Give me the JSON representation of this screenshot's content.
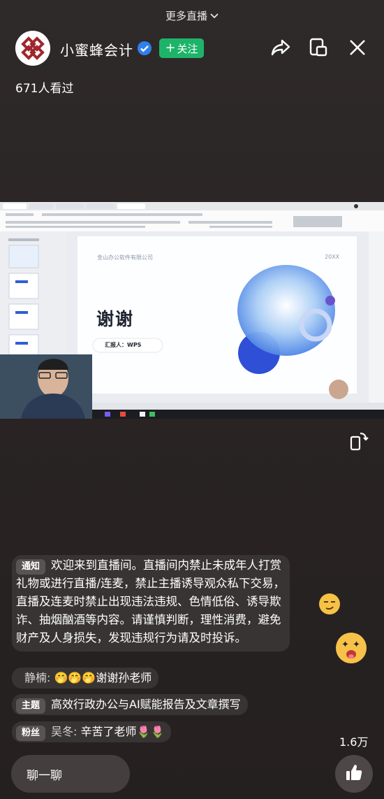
{
  "header": {
    "more_live": "更多直播",
    "host_name": "小蜜蜂会计",
    "follow_label": "关注",
    "viewers": "671人看过"
  },
  "colors": {
    "follow": "#1db46a",
    "verified": "#2f80ed",
    "avatar_brand": "#a0262c"
  },
  "icons": [
    "chevron-down-icon",
    "verified-icon",
    "share-icon",
    "float-window-icon",
    "close-icon",
    "rotate-screen-icon",
    "thumbs-up-icon"
  ],
  "slide": {
    "company": "金山办公软件有限公司",
    "year": "20XX",
    "title": "谢谢",
    "reporter": "汇报人：WPS"
  },
  "chat": {
    "notice_tag": "通知",
    "notice_text": "欢迎来到直播间。直播间内禁止未成年人打赏礼物或进行直播/连麦，禁止主播诱导观众私下交易，直播及连麦时禁止出现违法违规、色情低俗、诱导欺诈、抽烟酗酒等内容。请谨慎判断，理性消费，避免财产及人身损失，发现违规行为请及时投诉。",
    "m2_user": "静楠:",
    "m2_text": "🤭🤭🤭谢谢孙老师",
    "m3_tag": "主题",
    "m3_text": "高效行政办公与AI赋能报告及文章撰写",
    "m4_tag": "粉丝",
    "m4_user": "吴冬:",
    "m4_text": "辛苦了老师🌷🌷"
  },
  "footer": {
    "chat_placeholder": "聊一聊",
    "like_count": "1.6万"
  }
}
